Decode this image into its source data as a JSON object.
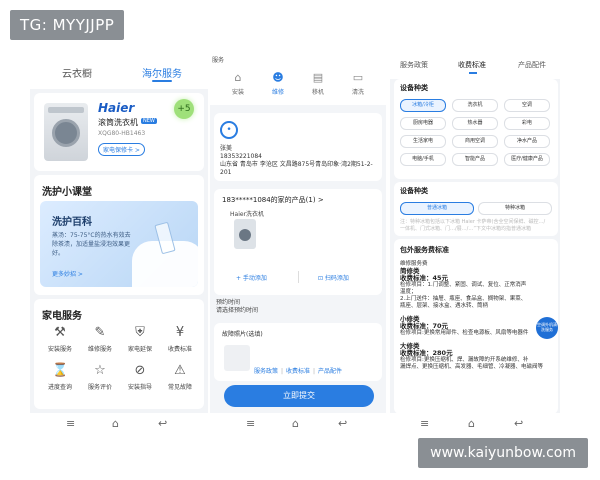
{
  "watermark_top": "TG: MYYJJPP",
  "watermark_bottom": "www.kaiyunbow.com",
  "panel1": {
    "tabs": [
      "云衣橱",
      "海尔服务"
    ],
    "product": {
      "brand": "Haier",
      "name": "滚筒洗衣机",
      "badge": "NEW",
      "model": "XQG80-HB1463",
      "manual_label": "家电保修卡 >",
      "points": "+5"
    },
    "lesson": {
      "title": "洗护小课堂",
      "banner_title": "洗护百科",
      "banner_desc": "蒸汤：75-75°C的热水有效去除茶渍，加适量盐浸泡效果更好。",
      "more_label": "更多妙招 >"
    },
    "services": {
      "title": "家电服务",
      "items": [
        {
          "label": "安装服务",
          "icon": "wrench-icon"
        },
        {
          "label": "维修服务",
          "icon": "tools-icon"
        },
        {
          "label": "家电延保",
          "icon": "shield-icon"
        },
        {
          "label": "收费标准",
          "icon": "yen-icon"
        },
        {
          "label": "进度查询",
          "icon": "hourglass-icon"
        },
        {
          "label": "服务评价",
          "icon": "star-icon"
        },
        {
          "label": "安装指导",
          "icon": "compass-icon"
        },
        {
          "label": "常见故障",
          "icon": "alert-icon"
        }
      ]
    }
  },
  "panel2": {
    "header_title": "服务",
    "tabs": [
      {
        "label": "安装",
        "icon": "home-icon"
      },
      {
        "label": "维修",
        "icon": "person-icon"
      },
      {
        "label": "移机",
        "icon": "document-icon"
      },
      {
        "label": "清洗",
        "icon": "monitor-icon"
      }
    ],
    "address": {
      "name": "张美",
      "phone": "18353221084",
      "detail": "山东省 青岛市 李沧区 文昌路875号青岛印象·湾2期51-2-201"
    },
    "products": {
      "header": "183*****1084的家的产品(1) >",
      "item_name": "Haier洗衣机",
      "manual_add": "+ 手动添加",
      "scan_add": "⊡ 扫码添加"
    },
    "appointment": {
      "label": "预约时间",
      "placeholder": "请选择预约时间"
    },
    "photos_label": "故障照片(选填)",
    "links": [
      "服务政策",
      "收费标准",
      "产品配件"
    ],
    "submit_label": "立即提交"
  },
  "panel3": {
    "tabs": [
      "服务政策",
      "收费标准",
      "产品配件"
    ],
    "device_types_title": "设备种类",
    "device_types": [
      "冰箱/冷柜",
      "洗衣机",
      "空调",
      "厨房电器",
      "热水器",
      "彩电",
      "生活家电",
      "商用空调",
      "净水产品",
      "电脑/手机",
      "智能产品",
      "医疗/健康产品"
    ],
    "device_kind_title": "设备种类",
    "device_kinds": [
      "普通冰箱",
      "特种冰箱"
    ],
    "device_kind_note": "注：特种冰箱包括以下冰箱 Haier 卡萨帝(含全空间保鲜、磁控…/一体机、门式冰箱、门…/展…/…”下文中冰箱均指普通冰箱",
    "standard_title": "包外服务费标准",
    "standard_lines": [
      {
        "type": "text",
        "text": "维修服务费"
      },
      {
        "type": "bold",
        "text": "简修类"
      },
      {
        "type": "bold",
        "text": "收费标准：45元"
      },
      {
        "type": "text",
        "text": "检修项目：1.门调整、紧固、调试、复位、正常消声"
      },
      {
        "type": "text",
        "text": "温度；"
      },
      {
        "type": "text",
        "text": "2.上门送件：抽屉、瓶座、食品盒、搁物架、果菜、"
      },
      {
        "type": "text",
        "text": "瓶座、层架、接水盒、遇水转、筒柄"
      },
      {
        "type": "gap",
        "text": ""
      },
      {
        "type": "bold",
        "text": "小修类"
      },
      {
        "type": "bold",
        "text": "收费标准：70元"
      },
      {
        "type": "text",
        "text": "检修项目:更换常用部件、检查电源板、风扇等电器件"
      },
      {
        "type": "gap",
        "text": ""
      },
      {
        "type": "bold",
        "text": "大修类"
      },
      {
        "type": "bold",
        "text": "收费标准：280元"
      },
      {
        "type": "text",
        "text": "检修项目:更换压缩机、焊、漏故障的开系统维修、补"
      },
      {
        "type": "text",
        "text": "漏焊点、更换压缩机、高发器、毛细管、冷凝器、电磁阀等"
      }
    ],
    "fab_label": "空调外机清洗服务"
  }
}
